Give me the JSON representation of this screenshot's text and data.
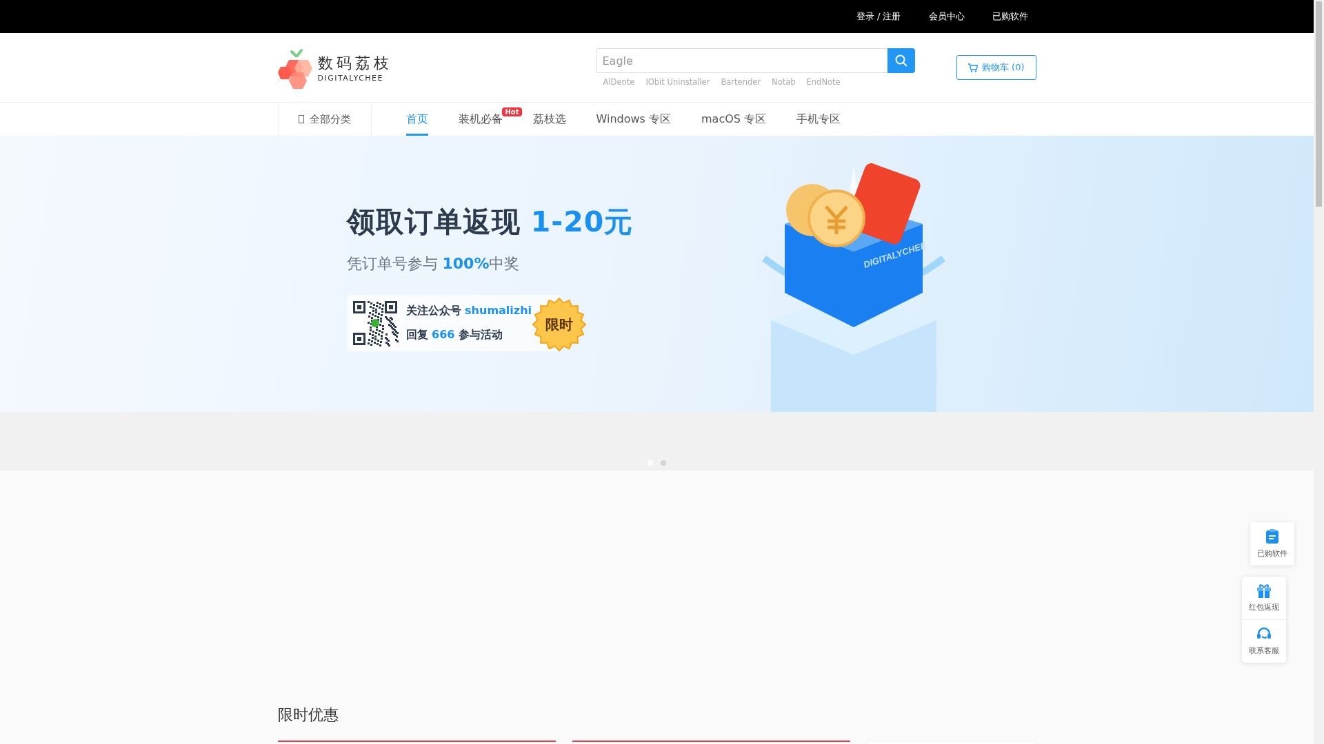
{
  "top_bar": {
    "links": [
      "登录 / 注册",
      "会员中心",
      "已购软件"
    ]
  },
  "header": {
    "logo": {
      "name": "数码荔枝",
      "subtitle": "DIGITALYCHEE"
    },
    "search": {
      "value": "Eagle"
    },
    "hot_words": [
      "AlDente",
      "IObit Uninstaller",
      "Bartender",
      "Notab",
      "EndNote"
    ],
    "cart": "购物车 (0)"
  },
  "nav": {
    "category": "全部分类",
    "items": [
      {
        "label": "首页",
        "selected": true
      },
      {
        "label": "装机必备",
        "selected": false,
        "badge": "Hot"
      },
      {
        "label": "荔枝选",
        "selected": false
      },
      {
        "label": "Windows 专区",
        "selected": false
      },
      {
        "label": "macOS 专区",
        "selected": false
      },
      {
        "label": "手机专区",
        "selected": false
      }
    ]
  },
  "banner": {
    "title": [
      {
        "text": "领取订单返现 ",
        "accent": false
      },
      {
        "text": "1-20元",
        "accent": true
      }
    ],
    "subtitle": [
      {
        "text": "凭订单号参与 ",
        "accent": false
      },
      {
        "text": "100%",
        "accent": true
      },
      {
        "text": "中奖",
        "accent": false
      }
    ],
    "qr_lines": [
      [
        {
          "text": "关注公众号 ",
          "accent": false
        },
        {
          "text": "shumalizhi",
          "accent": true
        }
      ],
      [
        {
          "text": "回复 ",
          "accent": false
        },
        {
          "text": "666",
          "accent": true
        },
        {
          "text": " 参与活动",
          "accent": false
        }
      ]
    ],
    "stamp": "限时",
    "illustration_label": "DIGITALYCHEE"
  },
  "carousel": {
    "dots": [
      {
        "selected": true
      },
      {
        "selected": false
      }
    ]
  },
  "section": {
    "title": "限时优惠",
    "cards": [
      {
        "kind": "accent"
      },
      {
        "kind": "accent"
      },
      {
        "kind": "plain"
      }
    ]
  },
  "float_panel": [
    {
      "kind": "doc",
      "label": "已购软件"
    },
    {
      "kind": "gift",
      "label": "红包返现"
    },
    {
      "kind": "headset",
      "label": "联系客服"
    }
  ]
}
